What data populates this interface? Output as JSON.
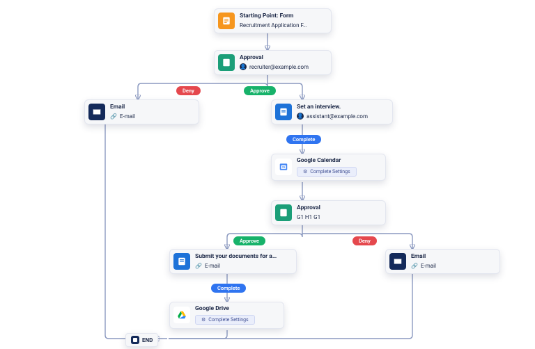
{
  "nodes": {
    "start": {
      "title": "Starting Point: Form",
      "subtitle": "Recruitment Application F…"
    },
    "approval1": {
      "title": "Approval",
      "subtitle": "recruiter@example.com"
    },
    "email_deny1": {
      "title": "Email",
      "subtitle": "E-mail"
    },
    "interview": {
      "title": "Set an interview.",
      "subtitle": "assistant@example.com"
    },
    "gcal": {
      "title": "Google Calendar",
      "button": "Complete Settings"
    },
    "approval2": {
      "title": "Approval",
      "tags": "G1 H1 G1"
    },
    "submit_docs": {
      "title": "Submit your documents for a…",
      "subtitle": "E-mail"
    },
    "email_deny2": {
      "title": "Email",
      "subtitle": "E-mail"
    },
    "gdrive": {
      "title": "Google Drive",
      "button": "Complete Settings"
    }
  },
  "pills": {
    "deny1": "Deny",
    "approve1": "Approve",
    "complete1": "Complete",
    "approve2": "Approve",
    "deny2": "Deny",
    "complete2": "Complete"
  },
  "end_label": "END"
}
